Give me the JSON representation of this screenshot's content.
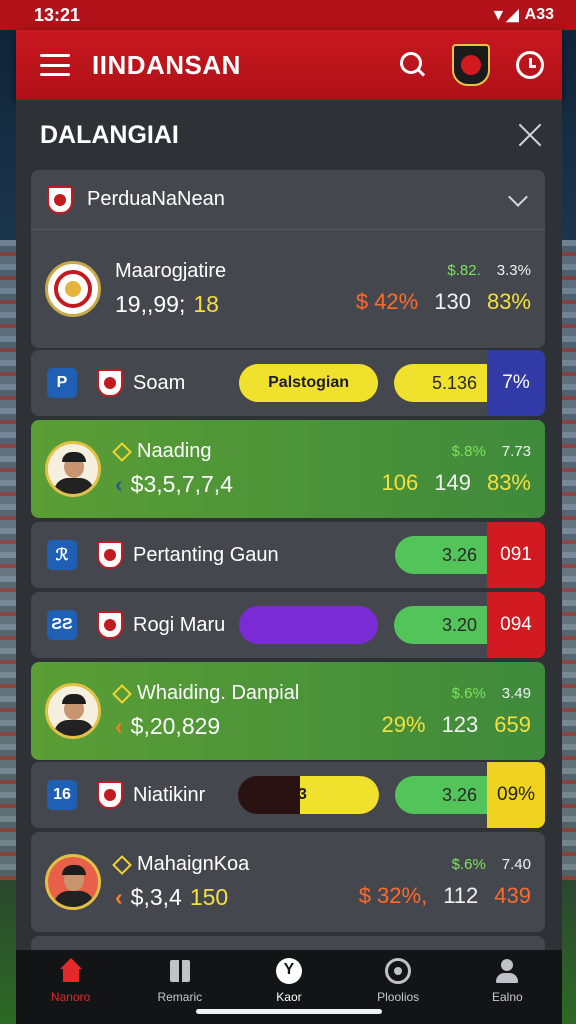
{
  "status": {
    "time": "13:21",
    "signal": "▼◢",
    "battery": "A33"
  },
  "header": {
    "title": "IINDANSAN"
  },
  "panel": {
    "title": "DALANGIAI",
    "dropdown_label": "PerduaNaNean"
  },
  "club_card": {
    "name": "Maarogjatire",
    "score": "19,,99;",
    "score_tail": "18",
    "stats_top": [
      "$.82.",
      "3.3%"
    ],
    "stats_bot": [
      "$ 42%",
      "130",
      "83%"
    ]
  },
  "teams": [
    {
      "badge": "P",
      "name": "Soam",
      "pill": "Palstogian",
      "score": "5.136",
      "end": "7%"
    },
    {
      "badge": "ℛ",
      "name": "Pertanting Gaun",
      "score": "3.26",
      "end": "091"
    },
    {
      "badge": "ƧƧ",
      "name": "Rogi Maru",
      "score": "3.20",
      "end": "094"
    },
    {
      "badge": "16",
      "name": "Niatikinr",
      "pill": "3",
      "score": "3.26",
      "end": "09%"
    }
  ],
  "players": [
    {
      "name": "Naading",
      "money": "$3,5,7,7,4",
      "stats_top": [
        "$.8%",
        "7.73"
      ],
      "stats_bot": [
        "106",
        "149",
        "83%"
      ]
    },
    {
      "name": "Whaiding. Danpial",
      "money": "$,20,829",
      "stats_top": [
        "$.6%",
        "3.49"
      ],
      "stats_bot": [
        "29%",
        "123",
        "659"
      ]
    },
    {
      "name": "MahaignKoa",
      "money": "$,3,4",
      "money_tail": "150",
      "stats_top": [
        "$.6%",
        "7.40"
      ],
      "stats_bot": [
        "$ 32%,",
        "112",
        "439"
      ]
    }
  ],
  "nav": [
    {
      "label": "Nanoro",
      "icon": "home-icon"
    },
    {
      "label": "Remaric",
      "icon": "grid-icon"
    },
    {
      "label": "Kaor",
      "icon": "ball-icon"
    },
    {
      "label": "Ploolios",
      "icon": "trophy-icon"
    },
    {
      "label": "Ealno",
      "icon": "user-icon"
    }
  ],
  "colors": {
    "brand_red": "#c8171f",
    "green": "#52c45a",
    "yellow": "#efe12c",
    "blue": "#323aa8",
    "purple": "#7a2bd6"
  }
}
